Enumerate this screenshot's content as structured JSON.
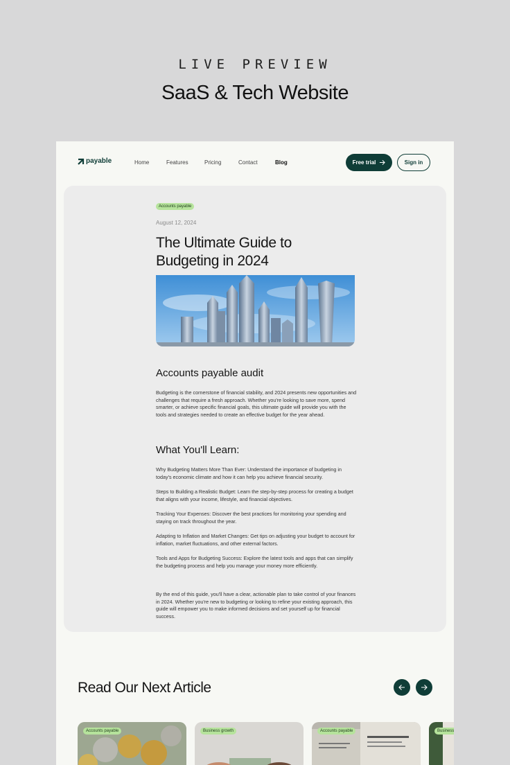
{
  "preview": {
    "kicker": "LIVE PREVIEW",
    "title": "SaaS & Tech Website"
  },
  "nav": {
    "logo": "payable",
    "links": [
      "Home",
      "Features",
      "Pricing",
      "Contact",
      "Blog"
    ],
    "active": "Blog",
    "free_trial": "Free trial",
    "sign_in": "Sign in"
  },
  "article": {
    "category": "Accounts payable",
    "date": "August 12, 2024",
    "title": "The Ultimate Guide to Budgeting in 2024",
    "section1_title": "Accounts payable audit",
    "section1_body": "Budgeting is the cornerstone of financial stability, and 2024 presents new opportunities and challenges that require a fresh approach. Whether you're looking to save more, spend smarter, or achieve specific financial goals, this ultimate guide will provide you with the tools and strategies needed to create an effective budget for the year ahead.",
    "section2_title": "What You'll Learn:",
    "learn_items": [
      "Why Budgeting Matters More Than Ever: Understand the importance of budgeting in today's economic climate and how it can help you achieve financial security.",
      "Steps to Building a Realistic Budget: Learn the step-by-step process for creating a budget that aligns with your income, lifestyle, and financial objectives.",
      "Tracking Your Expenses: Discover the best practices for monitoring your spending and staying on track throughout the year.",
      "Adapting to Inflation and Market Changes: Get tips on adjusting your budget to account for inflation, market fluctuations, and other external factors.",
      "Tools and Apps for Budgeting Success: Explore the latest tools and apps that can simplify the budgeting process and help you manage your money more efficiently."
    ],
    "conclusion": "By the end of this guide, you'll have a clear, actionable plan to take control of your finances in 2024. Whether you're new to budgeting or looking to refine your existing approach, this guide will empower you to make informed decisions and set yourself up for financial success."
  },
  "next": {
    "title": "Read Our Next Article",
    "cards": [
      {
        "category": "Accounts payable"
      },
      {
        "category": "Business growth"
      },
      {
        "category": "Accounts payable"
      },
      {
        "category": "Business g"
      }
    ]
  },
  "colors": {
    "brand": "#0f3d37",
    "badge": "#b6e39c",
    "page_bg": "#f7f8f4",
    "card_bg": "#ececec"
  }
}
